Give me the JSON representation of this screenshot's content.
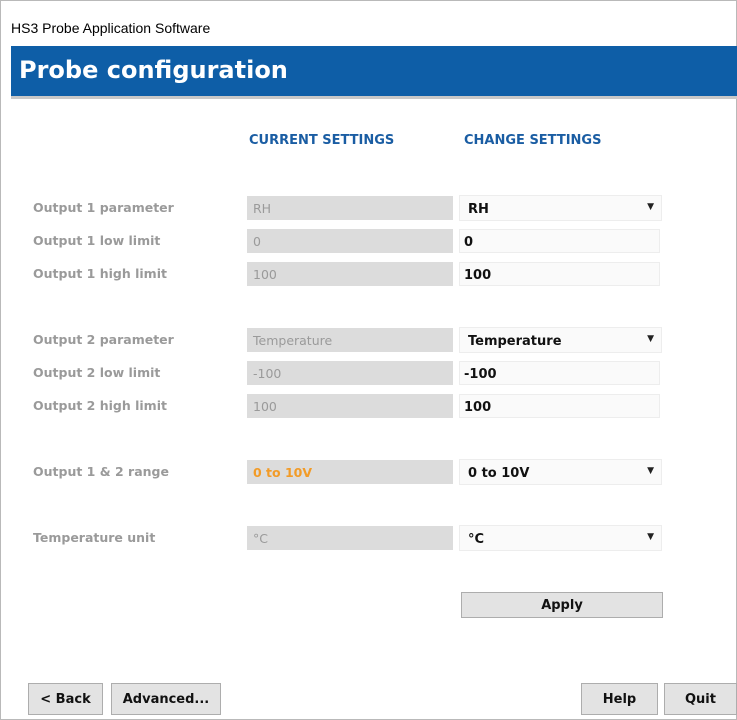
{
  "window": {
    "title": "HS3 Probe Application Software"
  },
  "banner": {
    "title": "Probe configuration"
  },
  "columns": {
    "current": "CURRENT SETTINGS",
    "change": "CHANGE SETTINGS"
  },
  "rows": [
    {
      "label": "Output 1 parameter",
      "current": "RH",
      "change": "RH",
      "control": "select"
    },
    {
      "label": "Output 1 low limit",
      "current": "0",
      "change": "0",
      "control": "input"
    },
    {
      "label": "Output 1 high limit",
      "current": "100",
      "change": "100",
      "control": "input"
    },
    {
      "label": "Output 2 parameter",
      "current": "Temperature",
      "change": "Temperature",
      "control": "select"
    },
    {
      "label": "Output 2 low limit",
      "current": "-100",
      "change": "-100",
      "control": "input"
    },
    {
      "label": "Output 2 high limit",
      "current": "100",
      "change": "100",
      "control": "input"
    },
    {
      "label": "Output 1 & 2 range",
      "current": "0 to 10V",
      "change": "0 to 10V",
      "control": "select"
    },
    {
      "label": "Temperature unit",
      "current": "°C",
      "change": "°C",
      "control": "select"
    }
  ],
  "buttons": {
    "apply": "Apply",
    "back": "< Back",
    "advanced": "Advanced...",
    "help": "Help",
    "quit": "Quit"
  },
  "icons": {
    "dropdown": "chevron-down-icon"
  },
  "colors": {
    "banner": "#0e5ea7",
    "header_text": "#1a5da3",
    "highlight": "#f29b27"
  }
}
